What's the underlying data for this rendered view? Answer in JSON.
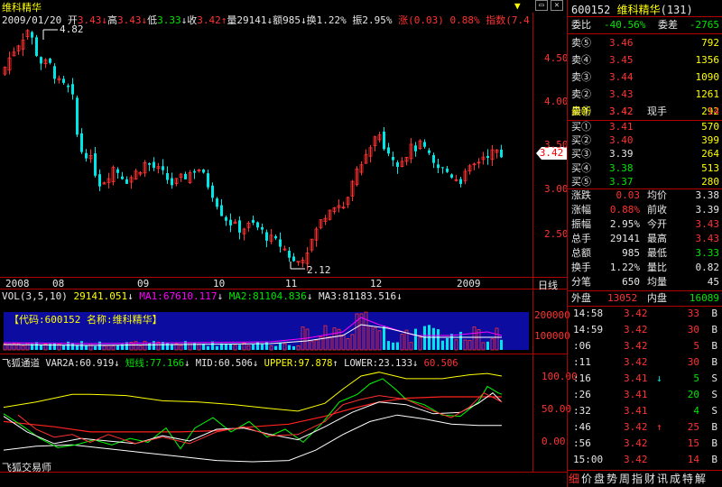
{
  "stock": {
    "name": "维科精华",
    "code": "600152",
    "count": "(131)"
  },
  "header": {
    "date": "2009/01/20",
    "open": {
      "label": "开",
      "value": "3.43",
      "arrow": "↓"
    },
    "high": {
      "label": "高",
      "value": "3.43",
      "arrow": "↓"
    },
    "low": {
      "label": "低",
      "value": "3.33",
      "arrow": "↓"
    },
    "close": {
      "label": "收",
      "value": "3.42",
      "arrow": "↑"
    },
    "volume": {
      "label": "量",
      "value": "29141",
      "arrow": "↓"
    },
    "amount": {
      "label": "额",
      "value": "985",
      "arrow": "↓"
    },
    "turnover": {
      "label": "换",
      "value": "1.22%"
    },
    "amplitude": {
      "label": "振",
      "value": "2.95%"
    },
    "change": {
      "label": "涨",
      "value": "(0.03)"
    },
    "change_pct": "0.88%",
    "index_label": "指数",
    "index_value": "(7.4"
  },
  "indicators": {
    "vol": {
      "label": "VOL(3,5,10)",
      "value": "29141.051",
      "ma1": "MA1:67610.117",
      "ma2": "MA2:81104.836",
      "ma3": "MA3:81183.516",
      "arrow": "↓"
    },
    "vol_box": "【代码:600152 名称:维科精华】",
    "fox": {
      "label": "飞狐通道",
      "var2a": "VAR2A:60.919",
      "short": "短线:77.166",
      "mid": "MID:60.506",
      "upper": "UPPER:97.878",
      "lower": "LOWER:23.133",
      "last": "60.506",
      "arrow_down": "↓",
      "arrow_up": "↑"
    },
    "trader": "飞狐交易师"
  },
  "annotations": {
    "high_mark": "4.82",
    "low_mark": "2.12",
    "price_tag": "3.42",
    "period": "日线"
  },
  "axis": {
    "price_ticks": [
      "4.50",
      "4.00",
      "3.50",
      "3.00",
      "2.50"
    ],
    "vol_ticks": [
      "200000",
      "100000"
    ],
    "fox_ticks": [
      "100.00",
      "50.00",
      "0.00"
    ],
    "x_labels": [
      "2008",
      "08",
      "09",
      "10",
      "11",
      "12",
      "2009"
    ]
  },
  "right": {
    "weibi": {
      "label": "委比",
      "value": "-40.56%",
      "cha_label": "委差",
      "cha_value": "-2765"
    },
    "sells": [
      {
        "label": "卖⑤",
        "price": "3.46",
        "vol": "792"
      },
      {
        "label": "卖④",
        "price": "3.45",
        "vol": "1356"
      },
      {
        "label": "卖③",
        "price": "3.44",
        "vol": "1090"
      },
      {
        "label": "卖②",
        "price": "3.43",
        "vol": "1261"
      },
      {
        "label": "卖①",
        "price": "3.42",
        "vol": "292"
      }
    ],
    "latest": {
      "label": "最新",
      "price": "3.42",
      "hand_label": "现手",
      "hand": "14"
    },
    "buys": [
      {
        "label": "买①",
        "price": "3.41",
        "vol": "570"
      },
      {
        "label": "买②",
        "price": "3.40",
        "vol": "399"
      },
      {
        "label": "买③",
        "price": "3.39",
        "vol": "264"
      },
      {
        "label": "买④",
        "price": "3.38",
        "vol": "513"
      },
      {
        "label": "买⑤",
        "price": "3.37",
        "vol": "280"
      }
    ],
    "stats": [
      {
        "l1": "涨跌",
        "v1": "0.03",
        "l2": "均价",
        "v2": "3.38"
      },
      {
        "l1": "涨幅",
        "v1": "0.88%",
        "l2": "前收",
        "v2": "3.39"
      },
      {
        "l1": "振幅",
        "v1": "2.95%",
        "l2": "今开",
        "v2": "3.43"
      },
      {
        "l1": "总手",
        "v1": "29141",
        "l2": "最高",
        "v2": "3.43"
      },
      {
        "l1": "总额",
        "v1": "985",
        "l2": "最低",
        "v2": "3.33"
      },
      {
        "l1": "换手",
        "v1": "1.22%",
        "l2": "量比",
        "v2": "0.82"
      },
      {
        "l1": "分笔",
        "v1": "650",
        "l2": "均量",
        "v2": "45"
      }
    ],
    "outer": {
      "label": "外盘",
      "value": "13052",
      "inner_label": "内盘",
      "inner_value": "16089"
    },
    "ticks": [
      {
        "time": "14:58",
        "price": "3.42",
        "vol": "33",
        "side": "B",
        "arrow": ""
      },
      {
        "time": "14:59",
        "price": "3.42",
        "vol": "30",
        "side": "B",
        "arrow": ""
      },
      {
        "time": ":06",
        "price": "3.42",
        "vol": "5",
        "side": "B",
        "arrow": ""
      },
      {
        "time": ":11",
        "price": "3.42",
        "vol": "30",
        "side": "B",
        "arrow": ""
      },
      {
        "time": ":16",
        "price": "3.41",
        "vol": "5",
        "side": "S",
        "arrow": "↓"
      },
      {
        "time": ":26",
        "price": "3.41",
        "vol": "20",
        "side": "S",
        "arrow": ""
      },
      {
        "time": ":32",
        "price": "3.41",
        "vol": "4",
        "side": "S",
        "arrow": ""
      },
      {
        "time": ":46",
        "price": "3.42",
        "vol": "25",
        "side": "B",
        "arrow": "↑"
      },
      {
        "time": ":56",
        "price": "3.42",
        "vol": "15",
        "side": "B",
        "arrow": ""
      },
      {
        "time": "15:00",
        "price": "3.42",
        "vol": "14",
        "side": "B",
        "arrow": ""
      }
    ],
    "bottom_tabs": [
      "细",
      "价",
      "盘",
      "势",
      "周",
      "指",
      "财",
      "讯",
      "成",
      "特",
      "解"
    ]
  },
  "colors": {
    "up": "#ff3232",
    "down": "#00e6e6",
    "border": "#b00000",
    "vol_bg": "#0c0ca0"
  }
}
